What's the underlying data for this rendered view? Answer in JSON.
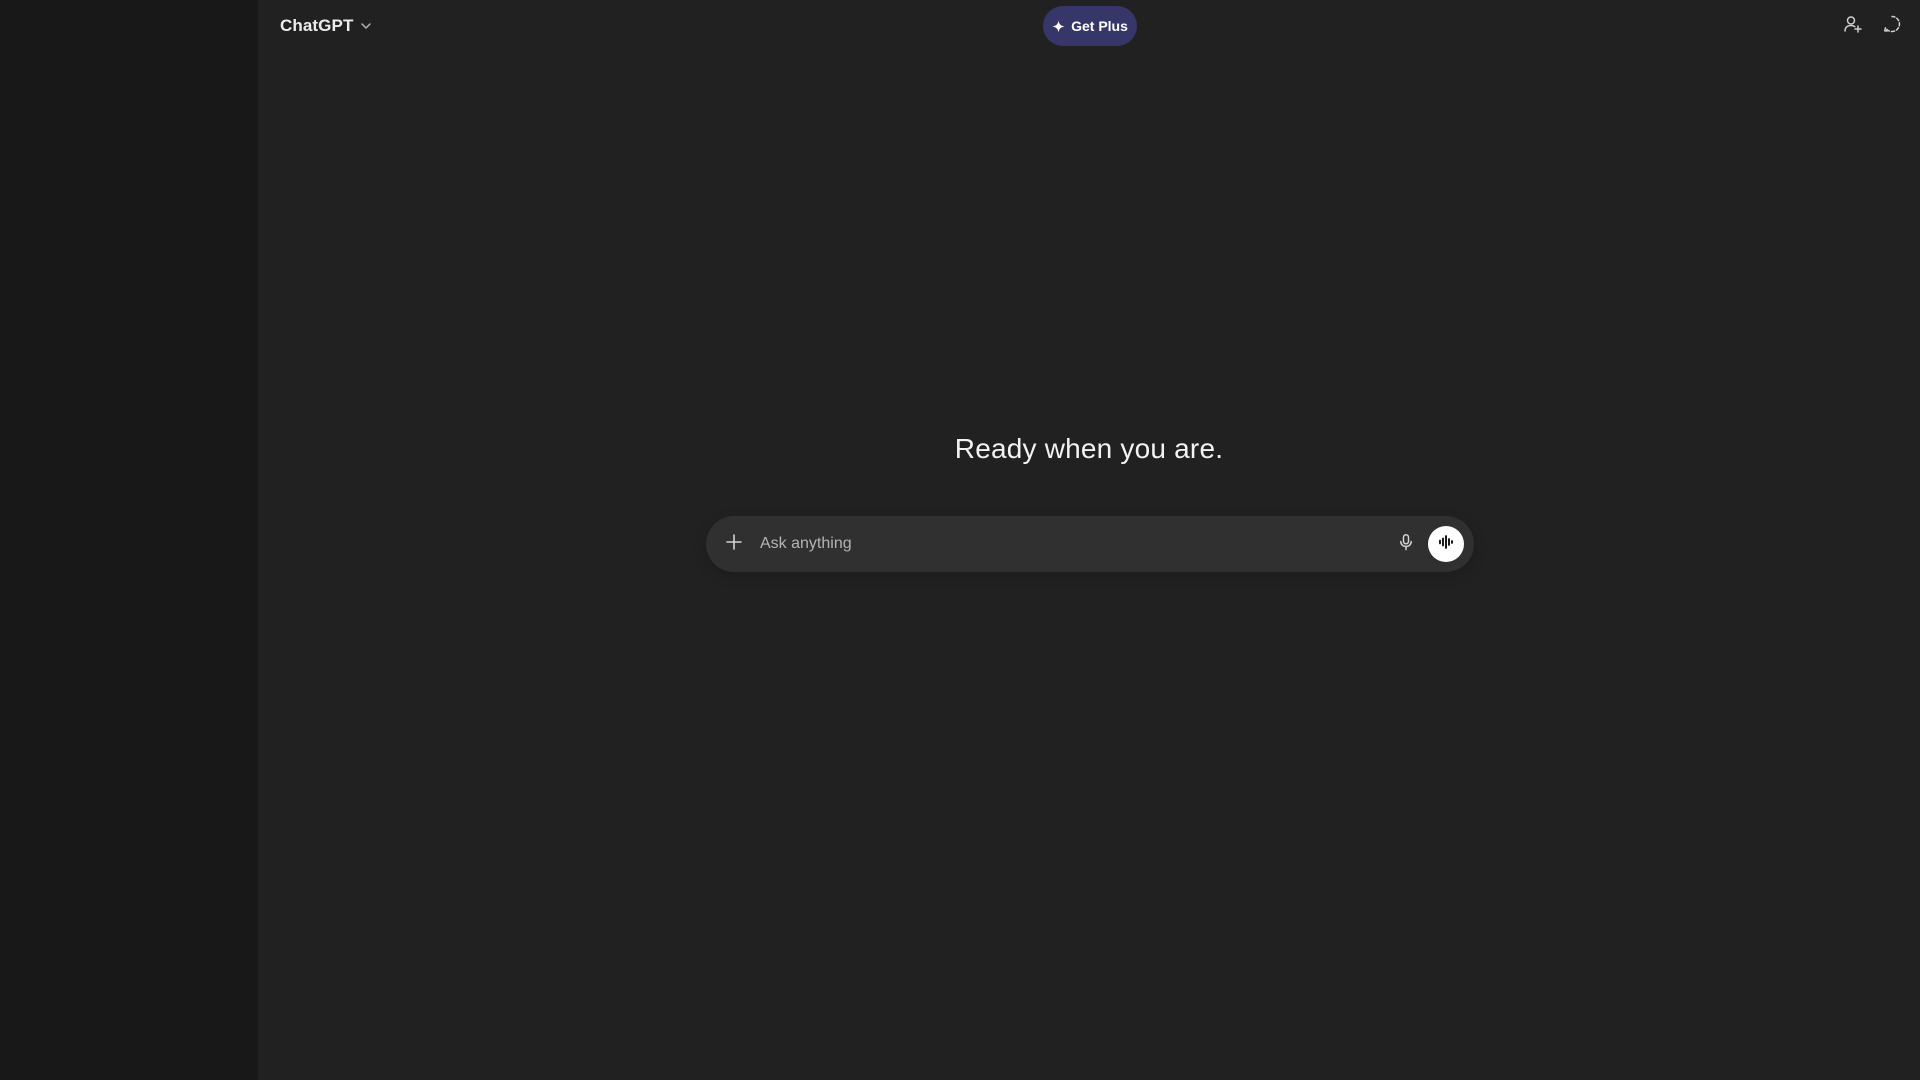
{
  "header": {
    "model_name": "ChatGPT",
    "model_menu_icon": "chevron-down-icon",
    "upgrade_label": "Get Plus",
    "upgrade_icon": "sparkle-icon",
    "upgrade_color": "#373669",
    "share_icon": "add-user-icon",
    "temporary_chat_icon": "temporary-chat-icon"
  },
  "main": {
    "headline": "Ready when you are."
  },
  "composer": {
    "placeholder": "Ask anything",
    "attach_icon": "plus-icon",
    "dictate_icon": "microphone-icon",
    "voice_mode_icon": "voice-waveform-icon"
  },
  "colors": {
    "sidebar_bg": "#181818",
    "main_bg": "#212121",
    "composer_bg": "#303030"
  }
}
